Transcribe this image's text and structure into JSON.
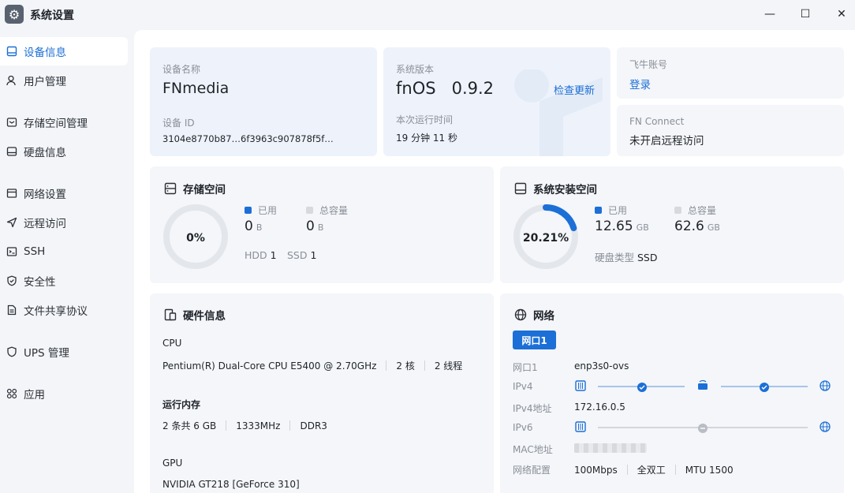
{
  "window": {
    "title": "系统设置",
    "minimize_glyph": "—",
    "maximize_glyph": "☐",
    "close_glyph": "✕"
  },
  "sidebar": {
    "items": [
      {
        "label": "设备信息",
        "icon": "device-icon",
        "active": true
      },
      {
        "label": "用户管理",
        "icon": "user-icon"
      },
      {
        "label": "存储空间管理",
        "icon": "storage-icon"
      },
      {
        "label": "硬盘信息",
        "icon": "disk-icon"
      },
      {
        "label": "网络设置",
        "icon": "network-icon"
      },
      {
        "label": "远程访问",
        "icon": "remote-icon"
      },
      {
        "label": "SSH",
        "icon": "ssh-icon"
      },
      {
        "label": "安全性",
        "icon": "shield-icon"
      },
      {
        "label": "文件共享协议",
        "icon": "file-share-icon"
      },
      {
        "label": "UPS 管理",
        "icon": "ups-icon"
      },
      {
        "label": "应用",
        "icon": "apps-icon"
      }
    ]
  },
  "device": {
    "name_label": "设备名称",
    "name": "FNmedia",
    "id_label": "设备 ID",
    "id": "3104e8770b87…6f3963c907878f5f…"
  },
  "system": {
    "version_label": "系统版本",
    "version": "fnOS   0.9.2",
    "check_update": "检查更新",
    "uptime_label": "本次运行时间",
    "uptime": "19 分钟 11 秒"
  },
  "account": {
    "label": "飞牛账号",
    "login": "登录"
  },
  "fn_connect": {
    "label": "FN Connect",
    "status": "未开启远程访问"
  },
  "storage": {
    "title": "存储空间",
    "percent_text": "0%",
    "percent": 0,
    "used_label": "已用",
    "used_value": "0",
    "used_unit": "B",
    "total_label": "总容量",
    "total_value": "0",
    "total_unit": "B",
    "hdd_label": "HDD",
    "hdd_count": "1",
    "ssd_label": "SSD",
    "ssd_count": "1"
  },
  "sys_install": {
    "title": "系统安装空间",
    "percent_text": "20.21%",
    "percent": 20.21,
    "used_label": "已用",
    "used_value": "12.65",
    "used_unit": "GB",
    "total_label": "总容量",
    "total_value": "62.6",
    "total_unit": "GB",
    "disk_type_label": "硬盘类型",
    "disk_type": "SSD"
  },
  "hardware": {
    "title": "硬件信息",
    "cpu_label": "CPU",
    "cpu_model": "Pentium(R) Dual-Core CPU E5400 @ 2.70GHz",
    "cpu_cores": "2 核",
    "cpu_threads": "2 线程",
    "ram_label": "运行内存",
    "ram_slots": "2 条共 6 GB",
    "ram_speed": "1333MHz",
    "ram_type": "DDR3",
    "gpu_label": "GPU",
    "gpu_model": "NVIDIA GT218 [GeForce 310]"
  },
  "network": {
    "title": "网络",
    "tab": "网口1",
    "port_label": "网口1",
    "port_value": "enp3s0-ovs",
    "ipv4_label": "IPv4",
    "ipv4_addr_label": "IPv4地址",
    "ipv4_addr": "172.16.0.5",
    "ipv6_label": "IPv6",
    "mac_label": "MAC地址",
    "config_label": "网络配置",
    "speed": "100Mbps",
    "duplex": "全双工",
    "mtu": "MTU 1500"
  },
  "colors": {
    "accent": "#1c6fd6",
    "ring_bg": "#e3e6eb",
    "legend_total": "#d6d9de"
  }
}
